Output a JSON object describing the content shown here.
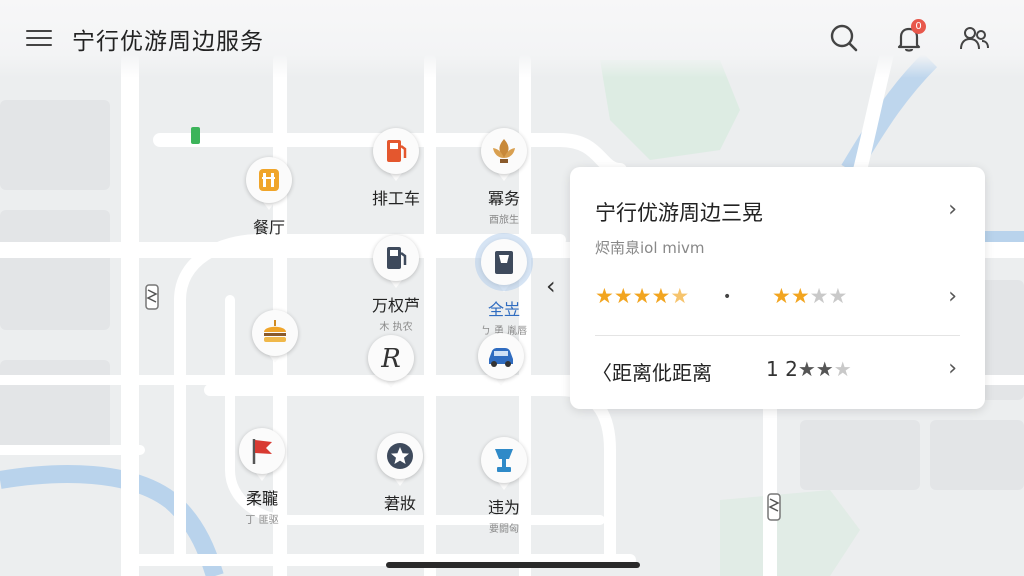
{
  "header": {
    "title": "宁行优游周边服务",
    "notification_count": "0"
  },
  "pois": [
    {
      "id": "restaurant",
      "label": "餐厅",
      "sub": "",
      "icon": "fork-knife-icon",
      "accent": "#f0a52a"
    },
    {
      "id": "gas1",
      "label": "排工车",
      "sub": "",
      "icon": "gas-pump-icon",
      "accent": "#e4572e"
    },
    {
      "id": "service",
      "label": "冪务",
      "sub": "酉旅生",
      "icon": "lotus-icon",
      "accent": "#c8893a"
    },
    {
      "id": "gas2",
      "label": "万权芦",
      "sub": "木 执农",
      "icon": "gas-pump-icon",
      "accent": "#3e4a5c"
    },
    {
      "id": "selected",
      "label": "全岦",
      "sub": "ㄅ 勇 胤唇",
      "icon": "booth-icon",
      "accent": "#3e4a5c"
    },
    {
      "id": "food2",
      "label": "",
      "sub": "",
      "icon": "burger-icon",
      "accent": "#f0a52a"
    },
    {
      "id": "r",
      "label": "",
      "sub": "",
      "icon": "letter-r-icon",
      "accent": "#333333"
    },
    {
      "id": "car",
      "label": "",
      "sub": "",
      "icon": "car-icon",
      "accent": "#2f6cc0"
    },
    {
      "id": "flag",
      "label": "柔䏊",
      "sub": "丁 匪驱",
      "icon": "flag-icon",
      "accent": "#d83a32"
    },
    {
      "id": "star",
      "label": "莙妝",
      "sub": "",
      "icon": "star-badge-icon",
      "accent": "#3e4a5c"
    },
    {
      "id": "trophy",
      "label": "违为",
      "sub": "要闘匈",
      "icon": "trophy-icon",
      "accent": "#2f8ac8"
    }
  ],
  "card": {
    "title": "宁行优游周边三晃",
    "subtitle": "烬南臮iol mivm",
    "rating_a": {
      "filled": 4.5,
      "total": 5
    },
    "rating_b": {
      "filled": 2,
      "total": 4
    },
    "distance_label": "〈距离仳距离",
    "distance_value": "1 2",
    "rating_c": {
      "filled": 2,
      "total": 3
    }
  },
  "colors": {
    "star_on": "#f2a520",
    "river": "#b9d3ec",
    "park": "#cfe6d6"
  }
}
